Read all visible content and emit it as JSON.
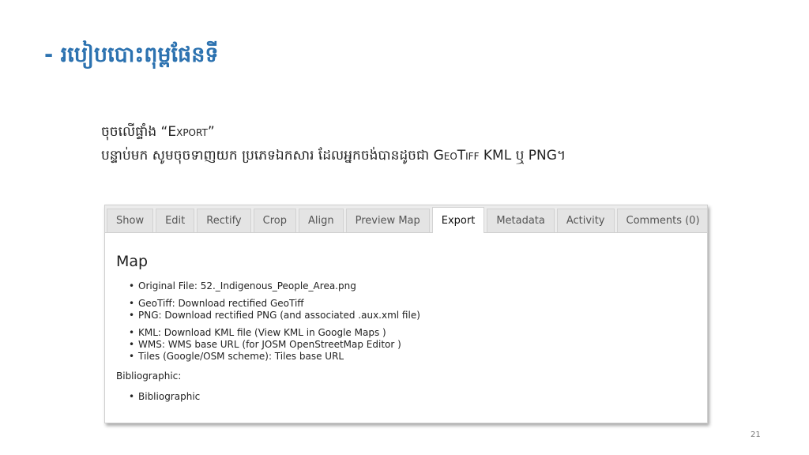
{
  "slide": {
    "title": "- របៀបបោះពុម្ពផែនទី",
    "line1_prefix": "ចុចលើផ្ទាំង “",
    "line1_keyword": "Export",
    "line1_suffix": "”",
    "line2_prefix": "បន្ទាប់មក សូមចុចទាញយក ប្រភេទឯកសារ ដែលអ្នកចង់បានដូចជា ",
    "line2_keyword": "GeoTiff",
    "line2_suffix": " KML ឬ PNG។",
    "page_number": "21"
  },
  "tabs": [
    {
      "label": "Show"
    },
    {
      "label": "Edit"
    },
    {
      "label": "Rectify"
    },
    {
      "label": "Crop"
    },
    {
      "label": "Align"
    },
    {
      "label": "Preview Map"
    },
    {
      "label": "Export",
      "active": true
    },
    {
      "label": "Metadata"
    },
    {
      "label": "Activity"
    },
    {
      "label": "Comments (0)"
    }
  ],
  "panel": {
    "heading": "Map",
    "original_file": "Original File: 52._Indigenous_People_Area.png",
    "geotiff": "GeoTiff: Download rectified GeoTiff",
    "png": "PNG: Download rectified PNG (and associated .aux.xml file)",
    "kml": "KML: Download KML file (View KML in Google Maps )",
    "wms": "WMS: WMS base URL (for JOSM OpenStreetMap Editor )",
    "tiles": "Tiles (Google/OSM scheme): Tiles base URL",
    "bibliographic_label": "Bibliographic:",
    "bibliographic_link": "Bibliographic"
  }
}
